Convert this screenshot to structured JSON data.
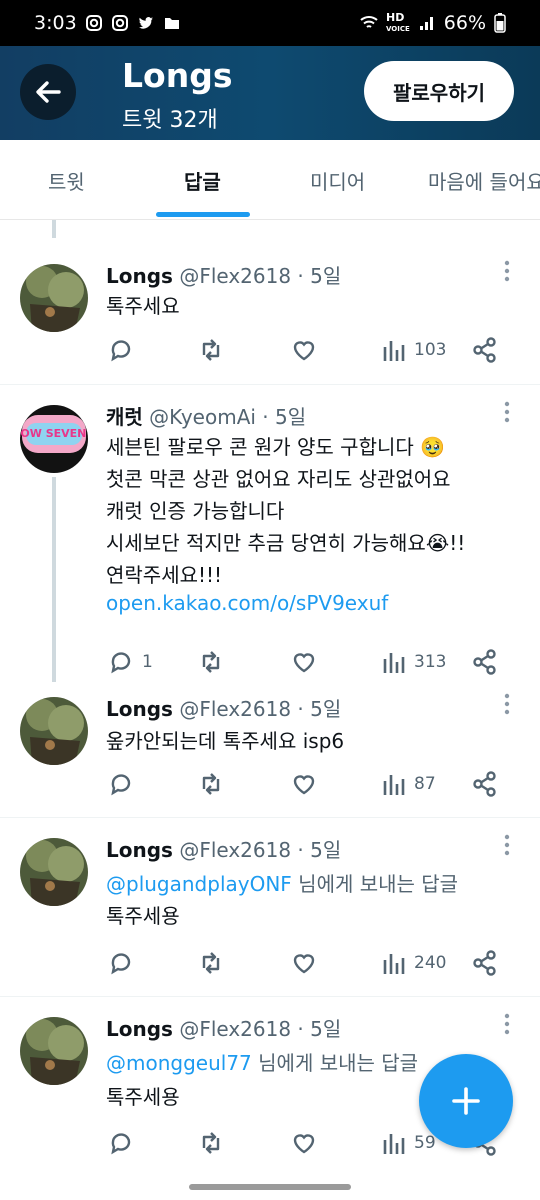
{
  "status_bar": {
    "time": "3:03",
    "battery": "66%",
    "left_icons": [
      "instagram-icon",
      "instagram-icon",
      "twitter-bird-icon",
      "folder-icon"
    ],
    "right_icons": [
      "wifi-icon",
      "hd-voice-icon",
      "signal-icon",
      "battery-icon"
    ]
  },
  "header": {
    "title": "Longs",
    "subtitle": "트윗 32개",
    "follow_label": "팔로우하기",
    "back_icon": "arrow-left-icon"
  },
  "tabs": [
    {
      "label": "트윗",
      "active": false
    },
    {
      "label": "답글",
      "active": true
    },
    {
      "label": "미디어",
      "active": false
    },
    {
      "label": "마음에 들어요",
      "active": false
    }
  ],
  "tweets": [
    {
      "name": "Longs",
      "meta": "@Flex2618 · 5일",
      "lines": [
        {
          "text": "톡주세요"
        }
      ],
      "stats": {
        "reply": "",
        "retweet": "",
        "like": "",
        "views": "103"
      }
    },
    {
      "name": "캐럿",
      "meta": "@KyeomAi · 5일",
      "lines": [
        {
          "text": "세븐틴 팔로우 콘 원가 양도 구합니다 🥹"
        },
        {
          "text": "첫콘 막콘 상관 없어요 자리도 상관없어요"
        },
        {
          "text": "캐럿 인증 가능합니다"
        },
        {
          "text": "시세보단 적지만 추금 당연히 가능해요😭!!"
        },
        {
          "text": "연락주세요!!!"
        },
        {
          "text": "open.kakao.com/o/sPV9exuf"
        }
      ],
      "stats": {
        "reply": "1",
        "retweet": "",
        "like": "",
        "views": "313"
      }
    },
    {
      "name": "Longs",
      "meta": "@Flex2618 · 5일",
      "lines": [
        {
          "text": "옾카안되는데 톡주세요 isp6"
        }
      ],
      "stats": {
        "reply": "",
        "retweet": "",
        "like": "",
        "views": "87"
      }
    },
    {
      "name": "Longs",
      "meta": "@Flex2618 · 5일",
      "mention": "@plugandplayONF",
      "mention_suffix": " 님에게 보내는 답글",
      "lines": [
        {
          "text": "톡주세용"
        }
      ],
      "stats": {
        "reply": "",
        "retweet": "",
        "like": "",
        "views": "240"
      }
    },
    {
      "name": "Longs",
      "meta": "@Flex2618 · 5일",
      "mention": "@monggeul77",
      "mention_suffix": " 님에게 보내는 답글",
      "lines": [
        {
          "text": "톡주세용"
        }
      ],
      "stats": {
        "reply": "",
        "retweet": "",
        "like": "",
        "views": "59"
      }
    }
  ],
  "avatar_text": "FOLLOW SEVENTEEN",
  "fab_icon": "plus-icon",
  "colors": {
    "accent": "#1d9bf0",
    "header_bg": "#0e4a70",
    "text_primary": "#0f1419",
    "text_secondary": "#536471"
  }
}
